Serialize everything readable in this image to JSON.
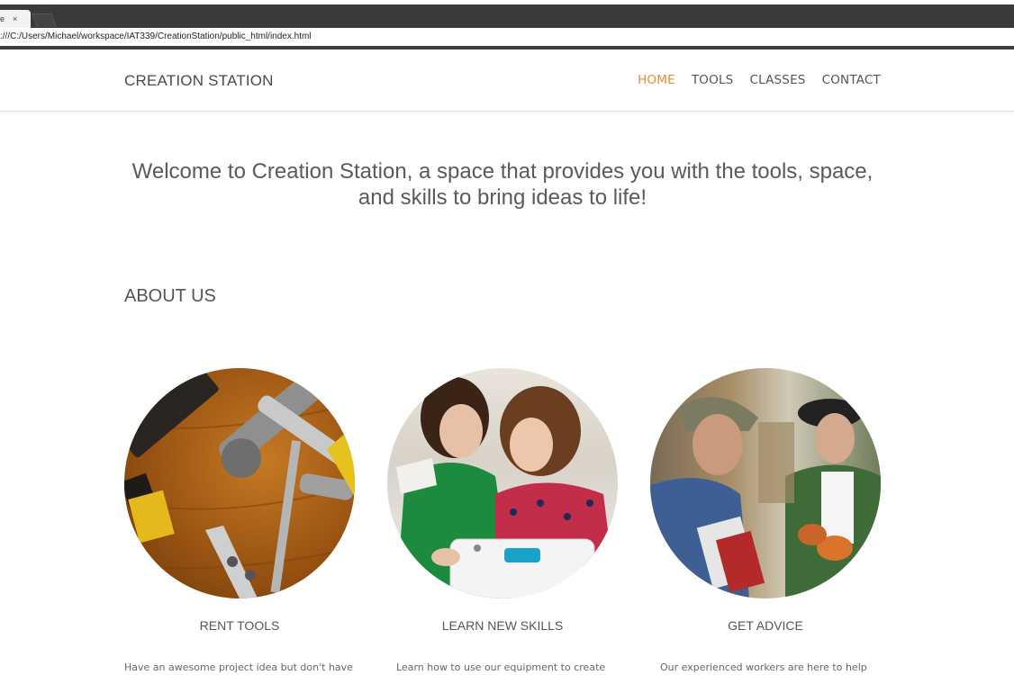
{
  "browser": {
    "tab_title": "e",
    "tab_close": "×",
    "address": ":///C:/Users/Michael/workspace/IAT339/CreationStation/public_html/index.html"
  },
  "header": {
    "brand": "CREATION STATION",
    "nav": [
      {
        "label": "HOME",
        "active": true
      },
      {
        "label": "TOOLS",
        "active": false
      },
      {
        "label": "CLASSES",
        "active": false
      },
      {
        "label": "CONTACT",
        "active": false
      }
    ]
  },
  "hero": {
    "line1": "Welcome to Creation Station, a space that provides you with the tools, space,",
    "line2": "and skills to bring ideas to life!"
  },
  "about": {
    "title": "ABOUT US",
    "features": [
      {
        "title": "RENT TOOLS",
        "text": "Have an awesome project idea but don't have"
      },
      {
        "title": "LEARN NEW SKILLS",
        "text": "Learn how to use our equipment to create"
      },
      {
        "title": "GET ADVICE",
        "text": "Our experienced workers are here to help"
      }
    ]
  },
  "colors": {
    "accent": "#e8892d",
    "nav_text": "#555555",
    "body_text": "#5a5a5a"
  }
}
